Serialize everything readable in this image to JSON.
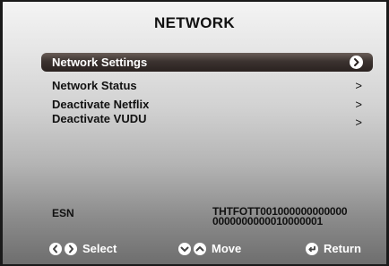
{
  "header": {
    "title": "NETWORK"
  },
  "menu": {
    "items": [
      {
        "label": "Network Settings",
        "selected": true
      },
      {
        "label": "Network Status",
        "chevron": ">"
      },
      {
        "label": "Deactivate Netflix",
        "chevron": ">"
      },
      {
        "label": "Deactivate VUDU",
        "chevron": ">"
      }
    ]
  },
  "esn": {
    "label": "ESN",
    "line1": "THTFOTT001000000000000",
    "line2": "0000000000010000001"
  },
  "footer": {
    "select_label": "Select",
    "move_label": "Move",
    "return_label": "Return"
  },
  "icons": {
    "select_left": "chevron-left-circle-icon",
    "select_right": "chevron-right-circle-icon",
    "move_down": "chevron-down-circle-icon",
    "move_up": "chevron-up-circle-icon",
    "return": "return-circle-icon"
  }
}
